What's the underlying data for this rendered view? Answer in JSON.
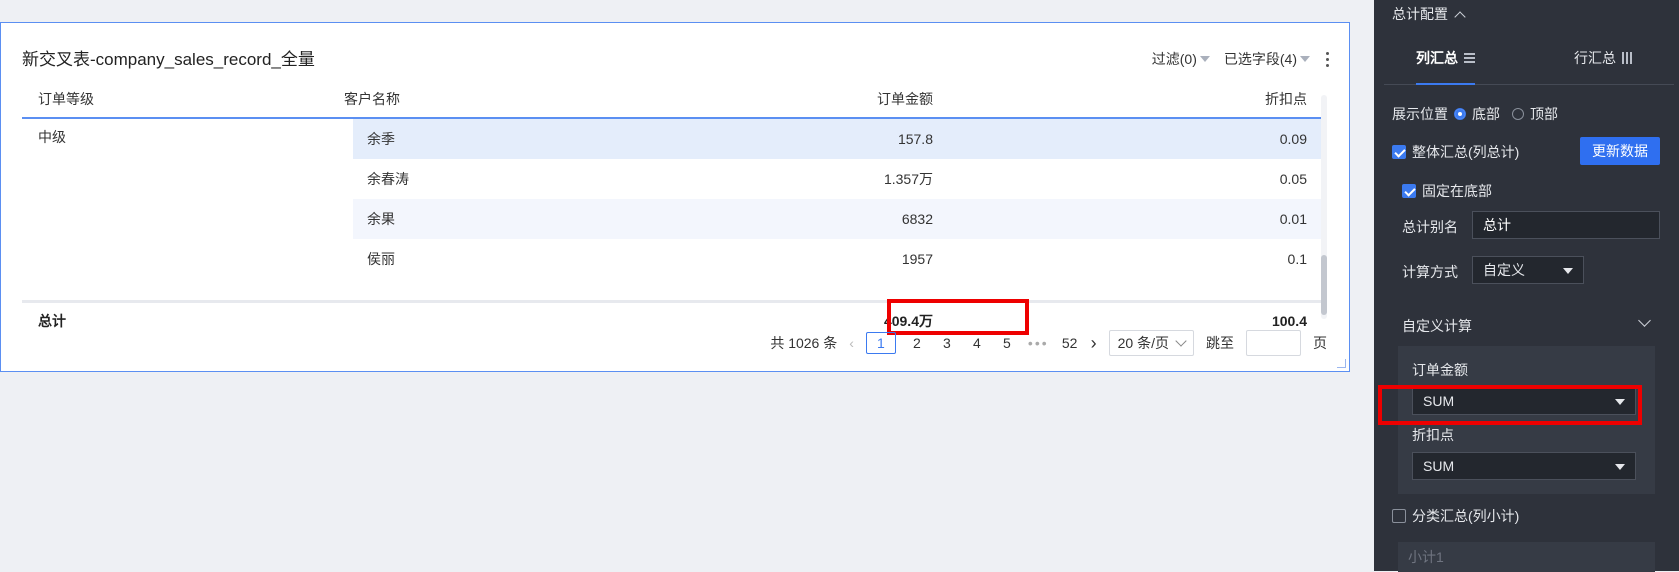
{
  "card": {
    "title": "新交叉表-company_sales_record_全量",
    "filter_label": "过滤(0)",
    "fields_label": "已选字段(4)"
  },
  "table": {
    "headers": [
      "订单等级",
      "客户名称",
      "订单金额",
      "折扣点"
    ],
    "group": "中级",
    "rows": [
      {
        "customer": "余季",
        "amount": "157.8",
        "discount": "0.09"
      },
      {
        "customer": "余春涛",
        "amount": "1.357万",
        "discount": "0.05"
      },
      {
        "customer": "余果",
        "amount": "6832",
        "discount": "0.01"
      },
      {
        "customer": "侯丽",
        "amount": "1957",
        "discount": "0.1"
      }
    ],
    "total": {
      "label": "总计",
      "amount": "409.4万",
      "discount": "100.4"
    }
  },
  "pager": {
    "total_text": "共 1026 条",
    "pages": [
      "1",
      "2",
      "3",
      "4",
      "5"
    ],
    "current": "1",
    "ellipsis": "•••",
    "last": "52",
    "page_size": "20 条/页",
    "jump_label": "跳至",
    "page_suffix": "页"
  },
  "panel": {
    "section_title": "总计配置",
    "tabs": [
      {
        "label": "列汇总",
        "active": true
      },
      {
        "label": "行汇总",
        "active": false
      }
    ],
    "position_label": "展示位置",
    "position_options": [
      "底部",
      "顶部"
    ],
    "position_selected": "底部",
    "overall_summary_label": "整体汇总(列总计)",
    "overall_summary_checked": true,
    "update_button": "更新数据",
    "fix_bottom_label": "固定在底部",
    "fix_bottom_checked": true,
    "alias_label": "总计别名",
    "alias_value": "总计",
    "calc_label": "计算方式",
    "calc_value": "自定义",
    "custom_calc_label": "自定义计算",
    "fields": [
      {
        "name": "订单金额",
        "agg": "SUM"
      },
      {
        "name": "折扣点",
        "agg": "SUM"
      }
    ],
    "category_summary_label": "分类汇总(列小计)",
    "category_summary_checked": false,
    "subtotal_placeholder": "小计1"
  },
  "colors": {
    "accent": "#3b7af0",
    "highlight": "#ee0000",
    "panel_bg": "#2e323b",
    "row_alt": "#f3f6fd",
    "row_selected": "#e4edfb"
  }
}
